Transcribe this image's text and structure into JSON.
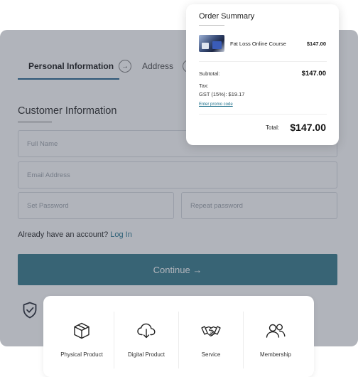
{
  "checkout": {
    "steps": {
      "active": "Personal Information",
      "next": "Address"
    },
    "section_title": "Customer Information",
    "fields": {
      "full_name_placeholder": "Full Name",
      "email_placeholder": "Email Address",
      "password_placeholder": "Set Password",
      "repeat_password_placeholder": "Repeat password"
    },
    "account_prompt": "Already have an account?",
    "login_link": "Log In",
    "continue_label": "Continue →"
  },
  "product_types": [
    {
      "label": "Physical Product",
      "icon": "box-icon"
    },
    {
      "label": "Digital Product",
      "icon": "cloud-download-icon"
    },
    {
      "label": "Service",
      "icon": "handshake-icon"
    },
    {
      "label": "Membership",
      "icon": "users-icon"
    }
  ],
  "order_summary": {
    "title": "Order Summary",
    "item_name": "Fat Loss Online Course",
    "item_price": "$147.00",
    "subtotal_label": "Subtotal:",
    "subtotal_value": "$147.00",
    "tax_label": "Tax:",
    "tax_value": "GST (15%): $19.17",
    "promo_link": "Enter promo code",
    "total_label": "Total:",
    "total_value": "$147.00"
  },
  "colors": {
    "accent": "#2f7687",
    "link": "#1d6f8a",
    "active_step_underline": "#1e5f8b"
  }
}
